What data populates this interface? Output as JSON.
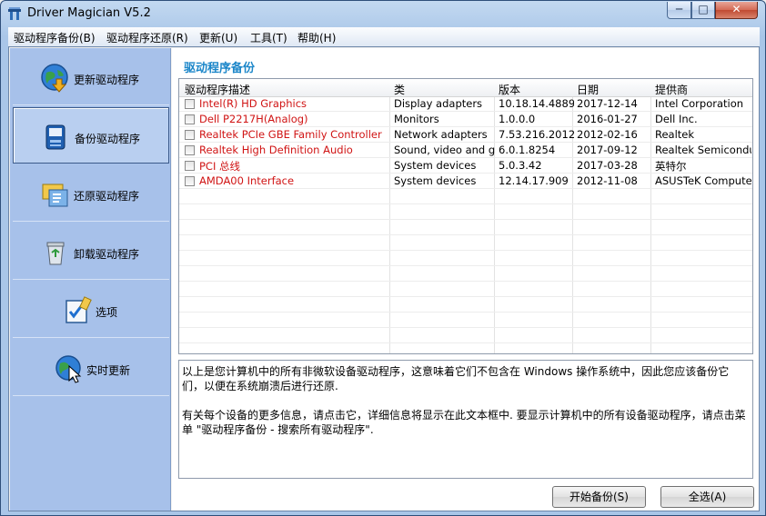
{
  "window": {
    "title": "Driver Magician V5.2",
    "min_label": "─",
    "max_label": "□",
    "close_label": "✕"
  },
  "menu": [
    {
      "label": "驱动程序备份(B)"
    },
    {
      "label": "驱动程序还原(R)"
    },
    {
      "label": "更新(U)"
    },
    {
      "label": "工具(T)"
    },
    {
      "label": "帮助(H)"
    }
  ],
  "sidebar": {
    "items": [
      {
        "label": "更新驱动程序",
        "icon": "globe-download-icon"
      },
      {
        "label": "备份驱动程序",
        "icon": "backup-icon"
      },
      {
        "label": "还原驱动程序",
        "icon": "restore-icon"
      },
      {
        "label": "卸载驱动程序",
        "icon": "recycle-bin-icon"
      },
      {
        "label": "选项",
        "icon": "options-checklist-icon"
      },
      {
        "label": "实时更新",
        "icon": "live-update-globe-icon"
      }
    ],
    "active_index": 1
  },
  "panel": {
    "title": "驱动程序备份",
    "columns": [
      "驱动程序描述",
      "类",
      "版本",
      "日期",
      "提供商"
    ],
    "rows": [
      [
        "Intel(R) HD Graphics",
        "Display adapters",
        "10.18.14.4889",
        "2017-12-14",
        "Intel Corporation"
      ],
      [
        "Dell P2217H(Analog)",
        "Monitors",
        "1.0.0.0",
        "2016-01-27",
        "Dell Inc."
      ],
      [
        "Realtek PCIe GBE Family Controller",
        "Network adapters",
        "7.53.216.2012",
        "2012-02-16",
        "Realtek"
      ],
      [
        "Realtek High Definition Audio",
        "Sound, video and g...",
        "6.0.1.8254",
        "2017-09-12",
        "Realtek Semicondu..."
      ],
      [
        "PCI 总线",
        "System devices",
        "5.0.3.42",
        "2017-03-28",
        "英特尔"
      ],
      [
        "AMDA00 Interface",
        "System devices",
        "12.14.17.909",
        "2012-11-08",
        "ASUSTeK Compute..."
      ]
    ],
    "description": [
      "以上是您计算机中的所有非微软设备驱动程序，这意味着它们不包含在 Windows 操作系统中，因此您应该备份它们，以便在系统崩溃后进行还原.",
      "有关每个设备的更多信息，请点击它，详细信息将显示在此文本框中. 要显示计算机中的所有设备驱动程序，请点击菜单 \"驱动程序备份 - 搜索所有驱动程序\"."
    ]
  },
  "buttons": {
    "start_backup": "开始备份(S)",
    "select_all": "全选(A)"
  },
  "colors": {
    "sidebar_bg": "#a7c1ea",
    "panel_title": "#1b86c9",
    "driver_name": "#d01414"
  }
}
